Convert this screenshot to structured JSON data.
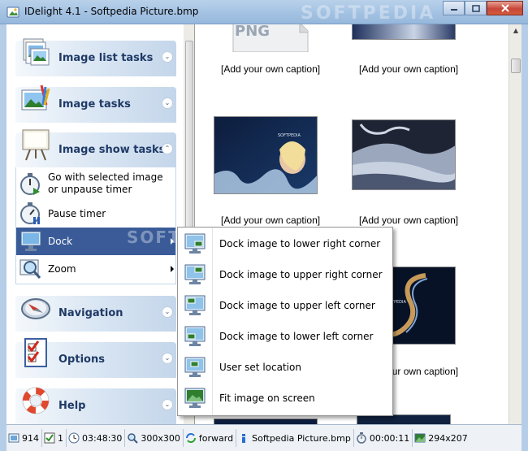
{
  "window": {
    "title": "IDelight 4.1 - Softpedia Picture.bmp",
    "watermark": "SOFTPEDIA",
    "accent": "#3a5b98"
  },
  "taskpanel": {
    "headers": [
      {
        "label": "Image list tasks",
        "icon": "image-list-icon",
        "state": "collapsed"
      },
      {
        "label": "Image tasks",
        "icon": "image-tasks-icon",
        "state": "collapsed"
      },
      {
        "label": "Image show tasks",
        "icon": "slideshow-easel-icon",
        "state": "expanded"
      },
      {
        "label": "Navigation",
        "icon": "compass-icon",
        "state": "collapsed"
      },
      {
        "label": "Options",
        "icon": "checklist-icon",
        "state": "collapsed"
      },
      {
        "label": "Help",
        "icon": "lifebuoy-icon",
        "state": "collapsed"
      }
    ],
    "items": [
      {
        "label": "Go with selected image",
        "label2": "or unpause timer",
        "icon": "stopwatch-play-icon"
      },
      {
        "label": "Pause timer",
        "icon": "stopwatch-pause-icon"
      },
      {
        "label": "Dock",
        "icon": "monitor-icon",
        "selected": true,
        "submenu": true
      },
      {
        "label": "Zoom",
        "icon": "magnifier-icon",
        "submenu": true
      }
    ]
  },
  "viewer": {
    "captions": [
      "[Add your own caption]",
      "[Add your own caption]",
      "[Add your own caption]",
      "[Add your own caption]",
      "[Add your own caption]"
    ],
    "png_label": "PNG"
  },
  "dock_menu": {
    "items": [
      {
        "label": "Dock image to lower right corner",
        "icon": "monitor-lower-right-icon"
      },
      {
        "label": "Dock image to upper right corner",
        "icon": "monitor-upper-right-icon"
      },
      {
        "label": "Dock image to upper left corner",
        "icon": "monitor-upper-left-icon"
      },
      {
        "label": "Dock image to lower left corner",
        "icon": "monitor-lower-left-icon"
      },
      {
        "label": "User set location",
        "icon": "monitor-user-icon"
      },
      {
        "label": "Fit image on screen",
        "icon": "monitor-fit-icon"
      }
    ]
  },
  "statusbar": {
    "image_count": "914",
    "selected_count": "1",
    "time": "03:48:30",
    "thumb_size": "300x300",
    "direction": "forward",
    "filename": "Softpedia Picture.bmp",
    "timer": "00:00:11",
    "image_size": "294x207"
  }
}
